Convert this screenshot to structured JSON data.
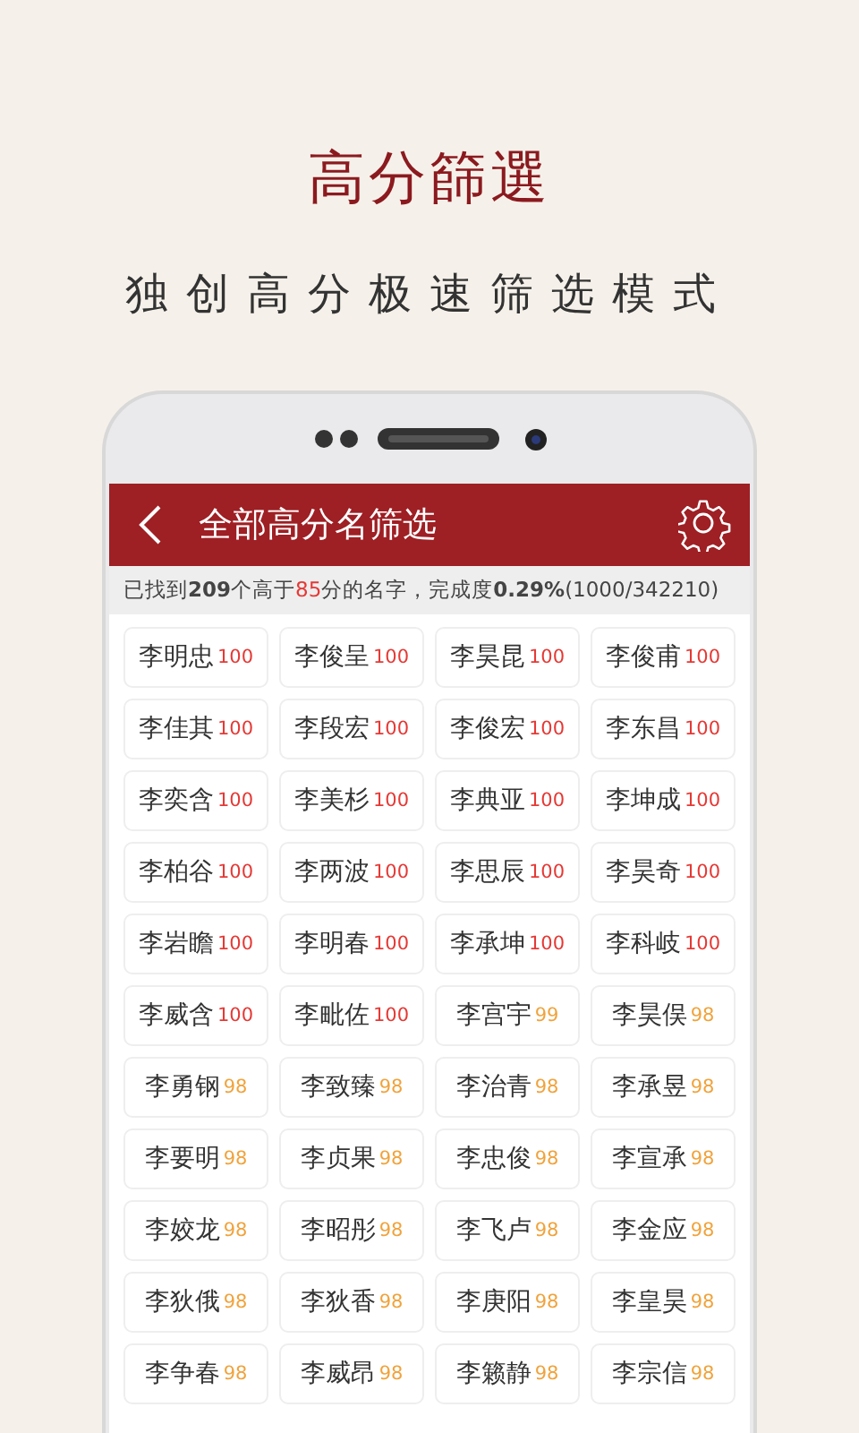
{
  "promo": {
    "title": "高分篩選",
    "subtitle": "独创高分极速筛选模式"
  },
  "header": {
    "title": "全部高分名筛选"
  },
  "status": [
    {
      "text": "已找到",
      "kind": "plain"
    },
    {
      "text": "209",
      "kind": "bold"
    },
    {
      "text": "个高于",
      "kind": "plain"
    },
    {
      "text": "85",
      "kind": "accent"
    },
    {
      "text": "分的名字，完成度",
      "kind": "plain"
    },
    {
      "text": "0.29%",
      "kind": "bold"
    },
    {
      "text": "(1000/342210)",
      "kind": "plain"
    }
  ],
  "names": [
    {
      "name": "李明忠",
      "score": "100",
      "color": "#e53935"
    },
    {
      "name": "李俊呈",
      "score": "100",
      "color": "#e53935"
    },
    {
      "name": "李昊昆",
      "score": "100",
      "color": "#e53935"
    },
    {
      "name": "李俊甫",
      "score": "100",
      "color": "#e53935"
    },
    {
      "name": "李佳其",
      "score": "100",
      "color": "#e53935"
    },
    {
      "name": "李段宏",
      "score": "100",
      "color": "#e53935"
    },
    {
      "name": "李俊宏",
      "score": "100",
      "color": "#e53935"
    },
    {
      "name": "李东昌",
      "score": "100",
      "color": "#e53935"
    },
    {
      "name": "李奕含",
      "score": "100",
      "color": "#e53935"
    },
    {
      "name": "李美杉",
      "score": "100",
      "color": "#e53935"
    },
    {
      "name": "李典亚",
      "score": "100",
      "color": "#e53935"
    },
    {
      "name": "李坤成",
      "score": "100",
      "color": "#e53935"
    },
    {
      "name": "李柏谷",
      "score": "100",
      "color": "#e53935"
    },
    {
      "name": "李两波",
      "score": "100",
      "color": "#e53935"
    },
    {
      "name": "李思辰",
      "score": "100",
      "color": "#e53935"
    },
    {
      "name": "李昊奇",
      "score": "100",
      "color": "#e53935"
    },
    {
      "name": "李岩瞻",
      "score": "100",
      "color": "#e53935"
    },
    {
      "name": "李明春",
      "score": "100",
      "color": "#e53935"
    },
    {
      "name": "李承坤",
      "score": "100",
      "color": "#e53935"
    },
    {
      "name": "李科岐",
      "score": "100",
      "color": "#e53935"
    },
    {
      "name": "李威含",
      "score": "100",
      "color": "#e53935"
    },
    {
      "name": "李毗佐",
      "score": "100",
      "color": "#e53935"
    },
    {
      "name": "李宫宇",
      "score": "99",
      "color": "#f0a33c"
    },
    {
      "name": "李昊俣",
      "score": "98",
      "color": "#f0a33c"
    },
    {
      "name": "李勇钢",
      "score": "98",
      "color": "#f0a33c"
    },
    {
      "name": "李致臻",
      "score": "98",
      "color": "#f0a33c"
    },
    {
      "name": "李治青",
      "score": "98",
      "color": "#f0a33c"
    },
    {
      "name": "李承昱",
      "score": "98",
      "color": "#f0a33c"
    },
    {
      "name": "李要明",
      "score": "98",
      "color": "#f0a33c"
    },
    {
      "name": "李贞果",
      "score": "98",
      "color": "#f0a33c"
    },
    {
      "name": "李忠俊",
      "score": "98",
      "color": "#f0a33c"
    },
    {
      "name": "李宣承",
      "score": "98",
      "color": "#f0a33c"
    },
    {
      "name": "李姣龙",
      "score": "98",
      "color": "#f0a33c"
    },
    {
      "name": "李昭彤",
      "score": "98",
      "color": "#f0a33c"
    },
    {
      "name": "李飞卢",
      "score": "98",
      "color": "#f0a33c"
    },
    {
      "name": "李金应",
      "score": "98",
      "color": "#f0a33c"
    },
    {
      "name": "李狄俄",
      "score": "98",
      "color": "#f0a33c"
    },
    {
      "name": "李狄香",
      "score": "98",
      "color": "#f0a33c"
    },
    {
      "name": "李庚阳",
      "score": "98",
      "color": "#f0a33c"
    },
    {
      "name": "李皇昊",
      "score": "98",
      "color": "#f0a33c"
    },
    {
      "name": "李争春",
      "score": "98",
      "color": "#f0a33c"
    },
    {
      "name": "李威昂",
      "score": "98",
      "color": "#f0a33c"
    },
    {
      "name": "李籁静",
      "score": "98",
      "color": "#f0a33c"
    },
    {
      "name": "李宗信",
      "score": "98",
      "color": "#f0a33c"
    }
  ]
}
